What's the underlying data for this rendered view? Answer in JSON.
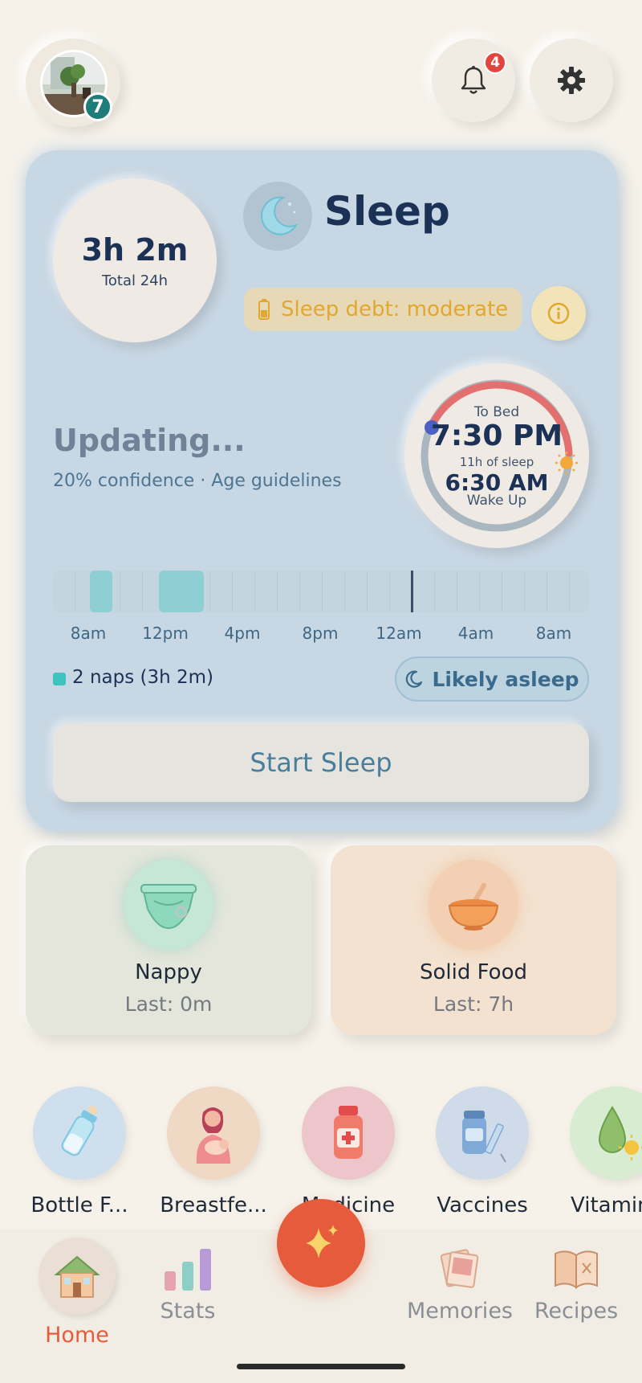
{
  "header": {
    "avatar_badge": "7",
    "notification_count": "4"
  },
  "sleep": {
    "title": "Sleep",
    "total_value": "3h 2m",
    "total_label": "Total 24h",
    "debt_label": "Sleep debt: moderate",
    "status": "Updating...",
    "confidence": "20% confidence · Age guidelines",
    "bed_label": "To Bed",
    "bed_time": "7:30 PM",
    "sleep_hours": "11h of sleep",
    "wake_time": "6:30 AM",
    "wake_label": "Wake Up",
    "timeline_labels": [
      "8am",
      "12pm",
      "4pm",
      "8pm",
      "12am",
      "4am",
      "8am"
    ],
    "naps_summary": "2 naps (3h 2m)",
    "likely_asleep": "Likely asleep",
    "start_button": "Start Sleep"
  },
  "cards": [
    {
      "title": "Nappy",
      "sub": "Last: 0m"
    },
    {
      "title": "Solid Food",
      "sub": "Last: 7h"
    }
  ],
  "quick_actions": [
    {
      "label": "Bottle F...",
      "icon": "bottle-icon"
    },
    {
      "label": "Breastfe...",
      "icon": "breastfeeding-icon"
    },
    {
      "label": "Medicine",
      "icon": "medicine-icon"
    },
    {
      "label": "Vaccines",
      "icon": "vaccine-icon"
    },
    {
      "label": "Vitamin",
      "icon": "vitamin-icon"
    }
  ],
  "nav": {
    "home": "Home",
    "stats": "Stats",
    "memories": "Memories",
    "recipes": "Recipes"
  },
  "colors": {
    "accent": "#e65b3c",
    "sleep_card": "#c8d7e4",
    "teal_badge": "#1f7d79",
    "debt_text": "#e1a72e"
  }
}
